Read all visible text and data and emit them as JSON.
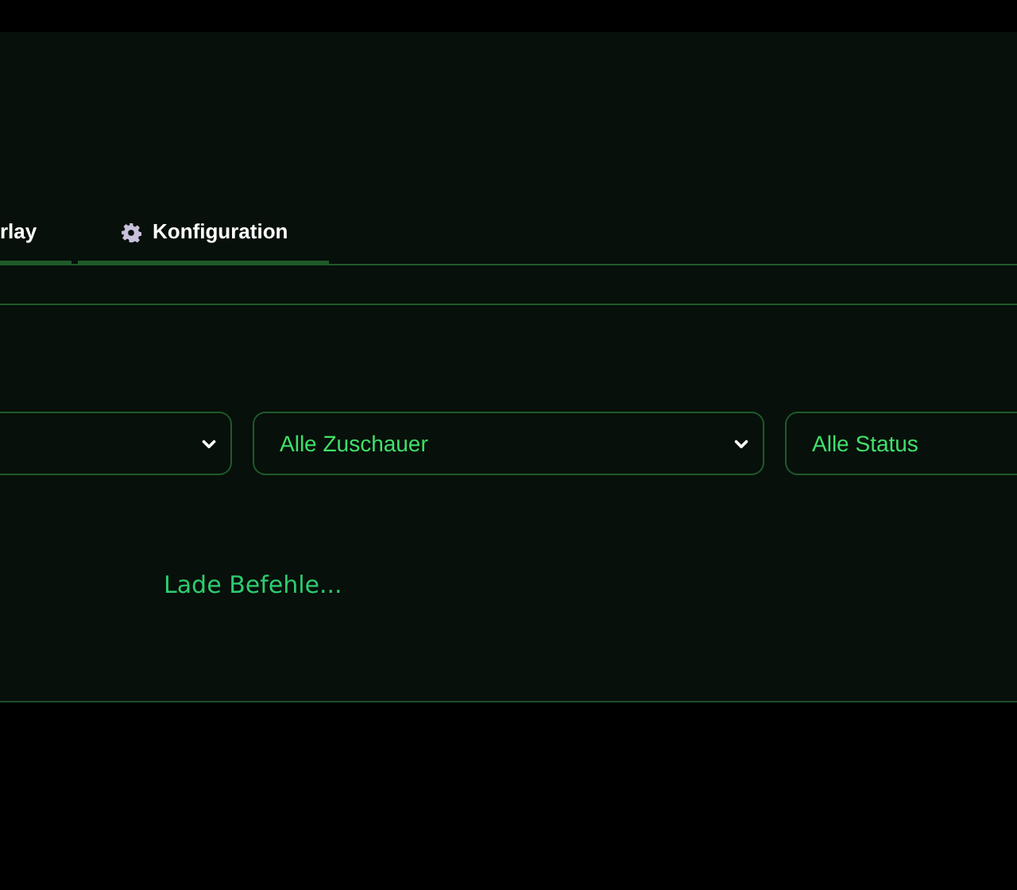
{
  "tabs": [
    {
      "label": "rlay",
      "kind": "text"
    },
    {
      "label": "Konfiguration",
      "kind": "icon"
    }
  ],
  "filters": [
    {
      "kind": "dropdown"
    },
    {
      "kind": "dropdown",
      "value": "Alle Zuschauer"
    },
    {
      "kind": "dropdown",
      "value": "Alle Status"
    }
  ],
  "status": "Lade Befehle..."
}
